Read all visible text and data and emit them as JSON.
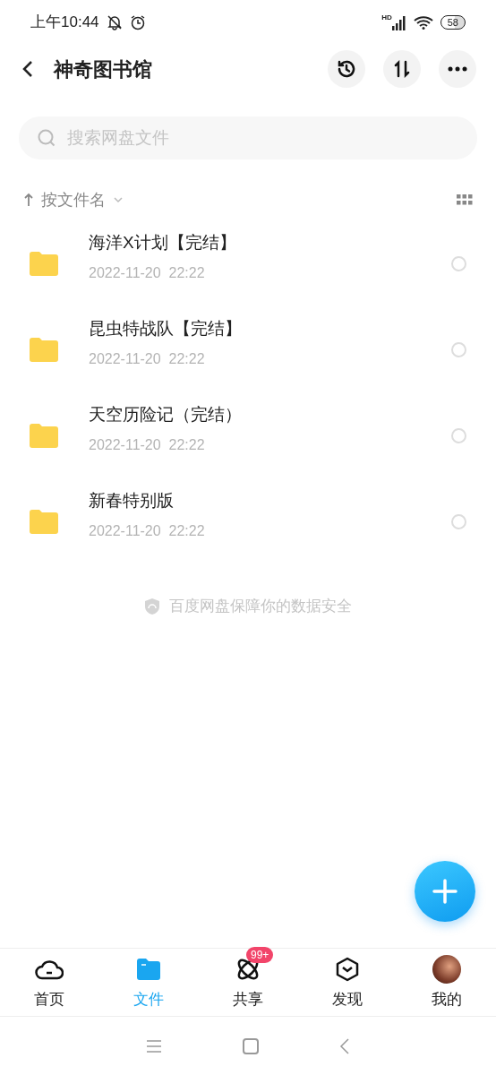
{
  "status_bar": {
    "time": "上午10:44",
    "network": "HD",
    "battery": "58"
  },
  "header": {
    "title": "神奇图书馆"
  },
  "search": {
    "placeholder": "搜索网盘文件"
  },
  "sort": {
    "label": "按文件名"
  },
  "files": [
    {
      "name": "海洋X计划【完结】",
      "date": "2022-11-20  22:22",
      "selected": false
    },
    {
      "name": "昆虫特战队【完结】",
      "date": "2022-11-20  22:22",
      "selected": false
    },
    {
      "name": "天空历险记（完结）",
      "date": "2022-11-20  22:22",
      "selected": false
    },
    {
      "name": "新春特别版",
      "date": "2022-11-20  22:22",
      "selected": false
    }
  ],
  "footer_note": "百度网盘保障你的数据安全",
  "nav": [
    {
      "kind": "home",
      "label": "首页",
      "selected": false
    },
    {
      "kind": "files",
      "label": "文件",
      "selected": true
    },
    {
      "kind": "share",
      "label": "共享",
      "selected": false,
      "badge": "99+"
    },
    {
      "kind": "discover",
      "label": "发现",
      "selected": false
    },
    {
      "kind": "me",
      "label": "我的",
      "selected": false
    }
  ]
}
